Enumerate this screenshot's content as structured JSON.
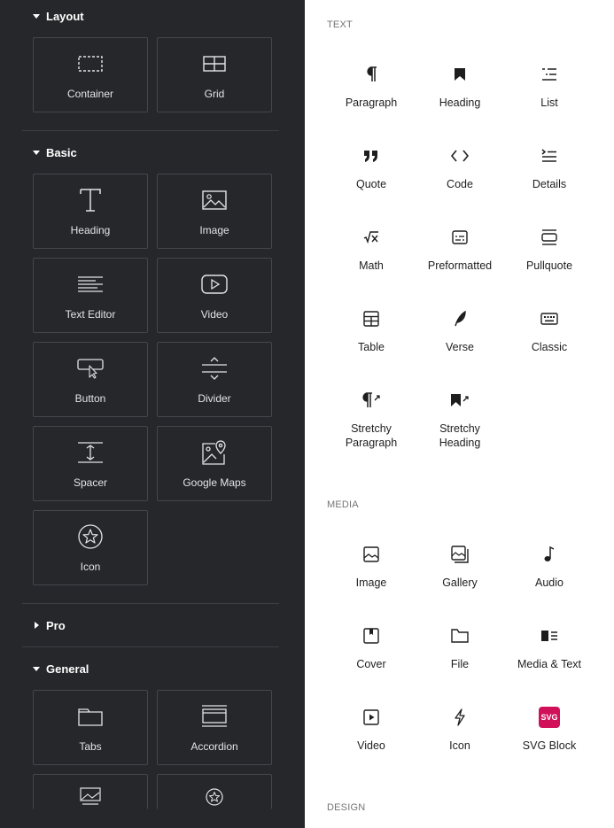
{
  "left_panel": {
    "sections": {
      "layout": "Layout",
      "basic": "Basic",
      "pro": "Pro",
      "general": "General"
    },
    "widgets": {
      "container": "Container",
      "grid": "Grid",
      "heading": "Heading",
      "image": "Image",
      "text_editor": "Text Editor",
      "video": "Video",
      "button": "Button",
      "divider": "Divider",
      "spacer": "Spacer",
      "google_maps": "Google Maps",
      "icon": "Icon",
      "tabs": "Tabs",
      "accordion": "Accordion"
    }
  },
  "right_panel": {
    "categories": {
      "text": "TEXT",
      "media": "MEDIA",
      "design": "DESIGN"
    },
    "text_blocks": {
      "paragraph": "Paragraph",
      "heading": "Heading",
      "list": "List",
      "quote": "Quote",
      "code": "Code",
      "details": "Details",
      "math": "Math",
      "preformatted": "Preformatted",
      "pullquote": "Pullquote",
      "table": "Table",
      "verse": "Verse",
      "classic": "Classic",
      "stretchy_paragraph_1": "Stretchy",
      "stretchy_paragraph_2": "Paragraph",
      "stretchy_heading_1": "Stretchy",
      "stretchy_heading_2": "Heading"
    },
    "media_blocks": {
      "image": "Image",
      "gallery": "Gallery",
      "audio": "Audio",
      "cover": "Cover",
      "file": "File",
      "media_text": "Media & Text",
      "video": "Video",
      "icon": "Icon",
      "svg_block": "SVG Block",
      "svg_badge": "SVG"
    }
  }
}
